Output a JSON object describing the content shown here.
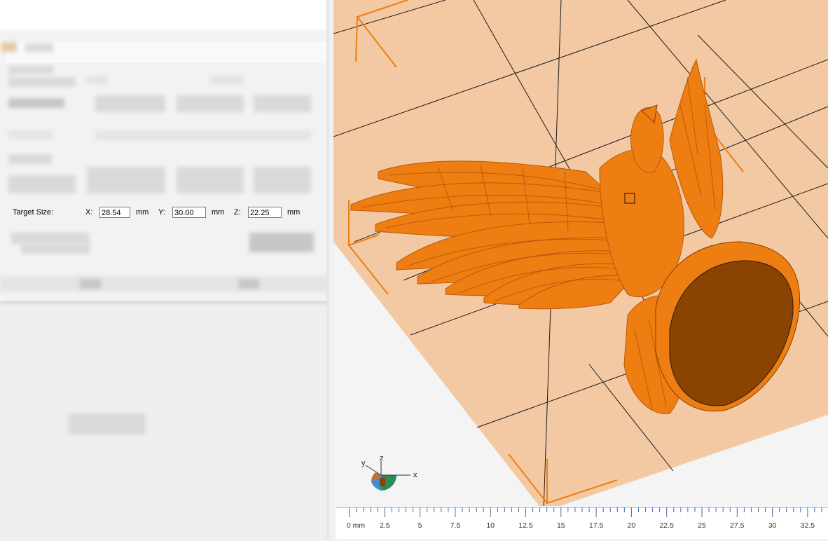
{
  "dialog": {
    "target_size_label": "Target Size:",
    "x_label": "X:",
    "y_label": "Y:",
    "z_label": "Z:",
    "x_value": "28.54",
    "y_value": "30.00",
    "z_value": "22.25",
    "unit": "mm"
  },
  "viewport": {
    "model": "eagle",
    "model_color": "#ee7d12",
    "bed_color": "#f2c9a3",
    "gizmo": {
      "x": "x",
      "y": "y",
      "z": "z"
    }
  },
  "ruler": {
    "labels": [
      "0 mm",
      "2.5",
      "5",
      "7.5",
      "10",
      "12.5",
      "15",
      "17.5",
      "20",
      "22.5",
      "25",
      "27.5",
      "30",
      "32.5"
    ]
  }
}
